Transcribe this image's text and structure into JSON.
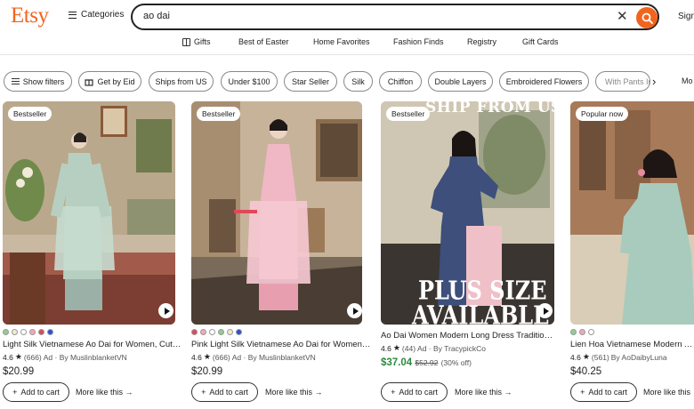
{
  "header": {
    "logo": "Etsy",
    "categories_label": "Categories",
    "search_value": "ao dai",
    "signin_label": "Sign"
  },
  "nav": {
    "items": [
      "Gifts",
      "Best of Easter",
      "Home Favorites",
      "Fashion Finds",
      "Registry",
      "Gift Cards"
    ]
  },
  "filters": {
    "show_filters": "Show filters",
    "items": [
      "Get by Eid",
      "Ships from US",
      "Under $100",
      "Star Seller",
      "Silk",
      "Chiffon",
      "Double Layers",
      "Embroidered Flowers",
      "With Pants In"
    ],
    "more_label": "Mo"
  },
  "listings": [
    {
      "badge": "Bestseller",
      "swatches": [
        "#8fcf8f",
        "#f2ead0",
        "#ffffff",
        "#f4a7b9",
        "#e0485a",
        "#2b4fd6"
      ],
      "title": "Light Silk Vietnamese Ao Dai for Women, Cute...",
      "rating": "4.6",
      "reviews": "(666)",
      "ad_by": "Ad · By MuslinblanketVN",
      "price": "$20.99",
      "cart_label": "Add to cart",
      "more_like": "More like this"
    },
    {
      "badge": "Bestseller",
      "swatches": [
        "#e0485a",
        "#f4a7b9",
        "#ffffff",
        "#8fcf8f",
        "#f2ead0",
        "#2b4fd6"
      ],
      "title": "Pink Light Silk Vietnamese Ao Dai for Women, ...",
      "rating": "4.6",
      "reviews": "(666)",
      "ad_by": "Ad · By MuslinblanketVN",
      "price": "$20.99",
      "cart_label": "Add to cart",
      "more_like": "More like this"
    },
    {
      "badge": "Bestseller",
      "overlay_top": "SHIP FROM US",
      "overlay_bottom_1": "PLUS SIZE",
      "overlay_bottom_2": "AVAILABLE",
      "title": "Ao Dai Women Modern Long Dress Traditional ...",
      "rating": "4.6",
      "reviews": "(44)",
      "ad_by": "Ad · By TracypickCo",
      "sale_price": "$37.04",
      "orig_price": "$52.92",
      "discount": "(30% off)",
      "cart_label": "Add to cart",
      "more_like": "More like this"
    },
    {
      "badge": "Popular now",
      "swatches": [
        "#8fcf8f",
        "#f4a7b9",
        "#ffffff"
      ],
      "title": "Lien Hoa Vietnamese Modern Ao ...",
      "rating": "4.6",
      "reviews": "(561)",
      "ad_by": "By AoDaibyLuna",
      "price": "$40.25",
      "cart_label": "Add to cart",
      "more_like": "More like this"
    }
  ],
  "colors": {
    "brand": "#f1641e",
    "sale_green": "#2b8a3e"
  }
}
